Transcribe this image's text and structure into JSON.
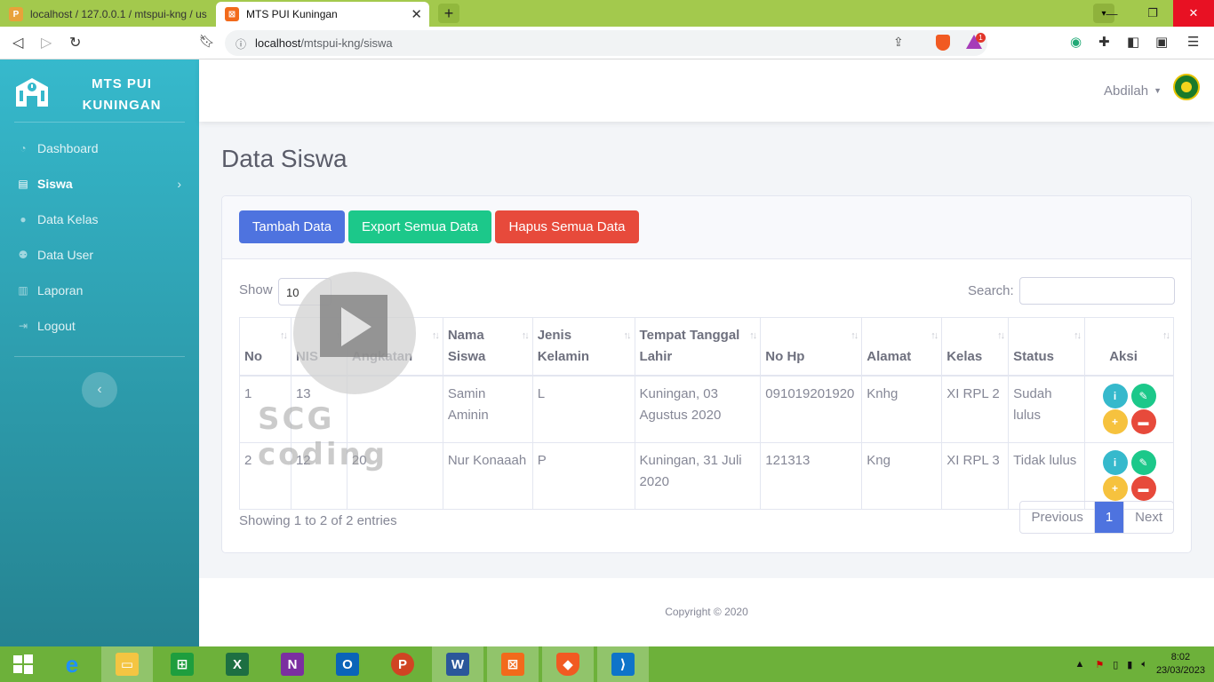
{
  "browser": {
    "tabs": [
      {
        "title": "localhost / 127.0.0.1 / mtspui-kng / us",
        "active": false
      },
      {
        "title": "MTS PUI Kuningan",
        "active": true
      }
    ],
    "address": {
      "host": "localhost",
      "path": "/mtspui-kng/siswa"
    },
    "bat_badge": "1"
  },
  "sidebar": {
    "brand_line1": "MTS PUI",
    "brand_line2": "KUNINGAN",
    "items": [
      {
        "label": "Dashboard",
        "icon": "tachometer-icon"
      },
      {
        "label": "Siswa",
        "icon": "table-icon",
        "active": true
      },
      {
        "label": "Data Kelas",
        "icon": "user-icon"
      },
      {
        "label": "Data User",
        "icon": "users-icon"
      },
      {
        "label": "Laporan",
        "icon": "chart-icon"
      },
      {
        "label": "Logout",
        "icon": "sign-out-icon"
      }
    ]
  },
  "topbar": {
    "username": "Abdilah"
  },
  "page": {
    "title": "Data Siswa"
  },
  "actions": {
    "add": "Tambah Data",
    "export": "Export Semua Data",
    "delete_all": "Hapus Semua Data"
  },
  "table_controls": {
    "show_label": "Show",
    "length_value": "10",
    "search_label": "Search:",
    "search_value": ""
  },
  "table": {
    "headers": [
      "No",
      "NIS",
      "Angkatan",
      "Nama Siswa",
      "Jenis Kelamin",
      "Tempat Tanggal Lahir",
      "No Hp",
      "Alamat",
      "Kelas",
      "Status",
      "Aksi"
    ],
    "rows": [
      [
        "1",
        "13",
        "",
        "Samin Aminin",
        "L",
        "Kuningan, 03 Agustus 2020",
        "091019201920",
        "Knhg",
        "XI RPL 2",
        "Sudah lulus"
      ],
      [
        "2",
        "12",
        "20",
        "Nur Konaaah",
        "P",
        "Kuningan, 31 Juli 2020",
        "121313",
        "Kng",
        "XI RPL 3",
        "Tidak lulus"
      ]
    ]
  },
  "info": "Showing 1 to 2 of 2 entries",
  "pagination": {
    "previous": "Previous",
    "current": "1",
    "next": "Next"
  },
  "footer": "Copyright © 2020",
  "watermark": "SCG coding",
  "taskbar": {
    "time": "8:02",
    "date": "23/03/2023"
  },
  "colors": {
    "primary": "#4e73df",
    "success": "#1cc88a",
    "danger": "#e74a3b",
    "info": "#36b9cc",
    "warning": "#f6c23e",
    "sidebar": "#36b9cc"
  }
}
